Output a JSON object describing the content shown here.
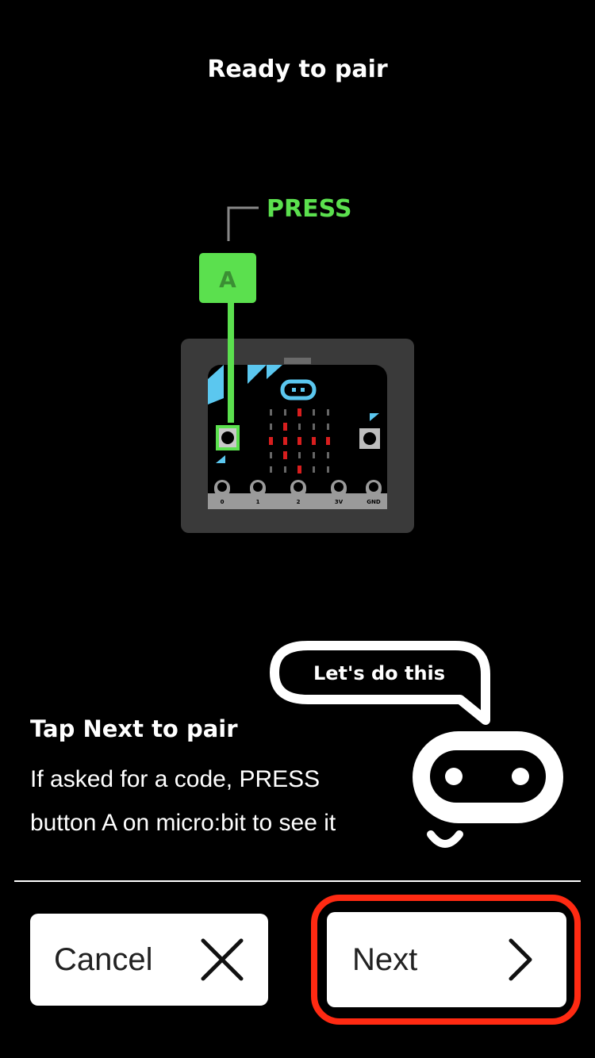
{
  "header": {
    "title": "Ready to pair"
  },
  "illustration": {
    "press_label": "PRESS",
    "button_a_label": "A",
    "pin_labels": [
      "0",
      "1",
      "2",
      "3V",
      "GND"
    ],
    "accent_color": "#5be04e",
    "led_color": "#d81e1e"
  },
  "mascot": {
    "speech_text": "Let's do this"
  },
  "instructions": {
    "heading": "Tap Next to pair",
    "line1": "If asked for a code, PRESS",
    "line2": "button A on micro:bit to see it"
  },
  "footer": {
    "cancel_label": "Cancel",
    "next_label": "Next",
    "highlight_color": "#ff2a12"
  }
}
